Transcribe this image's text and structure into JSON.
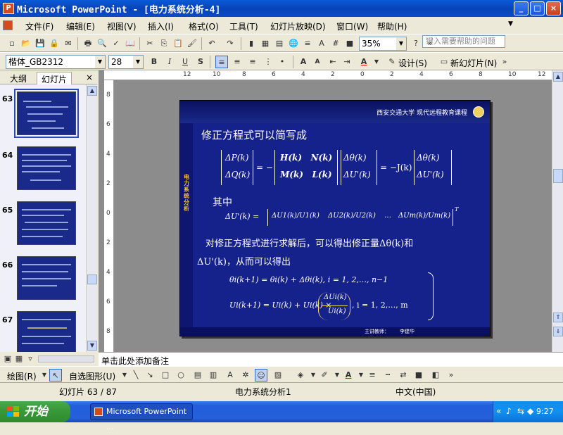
{
  "window": {
    "title": "Microsoft PowerPoint - [电力系统分析-4]",
    "controls": [
      "_",
      "□",
      "×"
    ]
  },
  "menu": {
    "items": [
      "文件(F)",
      "编辑(E)",
      "视图(V)",
      "插入(I)",
      "格式(O)",
      "工具(T)",
      "幻灯片放映(D)",
      "窗口(W)",
      "帮助(H)"
    ],
    "ask_placeholder": "键入需要帮助的问题"
  },
  "toolbar": {
    "zoom": "35%",
    "font_name": "楷体_GB2312",
    "font_size": "28",
    "design_label": "设计(S)",
    "new_slide_label": "新幻灯片(N)"
  },
  "left_pane": {
    "tabs": [
      "大纲",
      "幻灯片"
    ],
    "active_tab": "幻灯片",
    "slides": [
      "63",
      "64",
      "65",
      "66",
      "67"
    ],
    "selected": "63"
  },
  "rulers": {
    "h_ticks": [
      "12",
      "10",
      "8",
      "6",
      "4",
      "2",
      "0",
      "2",
      "4",
      "6",
      "8",
      "10",
      "12"
    ],
    "v_ticks": [
      "8",
      "6",
      "4",
      "2",
      "0",
      "2",
      "4",
      "6",
      "8"
    ]
  },
  "slide": {
    "header": "西安交通大学  现代远程教育课程",
    "side_title": "电力系统分析",
    "line1": "修正方程式可以简写成",
    "line2": "其中",
    "line3": "对修正方程式进行求解后，可以得出修正量Δθ(k)和",
    "line4": "ΔU'(k)，从而可以得出",
    "eq_main_lhs": [
      "ΔP(k)",
      "ΔQ(k)"
    ],
    "eq_main_mid": [
      "H(k)   N(k)",
      "M(k)   L(k)"
    ],
    "eq_main_vec": [
      "Δθ(k)",
      "ΔU'(k)"
    ],
    "eq_main_rhs_vec": [
      "Δθ(k)",
      "ΔU'(k)"
    ],
    "eq_main_sign": "= −",
    "eq_main_sign2": "= −J(k)",
    "eq_def_lhs": "ΔU'(k) =",
    "eq_def_terms": [
      "ΔU1(k)/U1(k)",
      "ΔU2(k)/U2(k)",
      "…",
      "ΔUm(k)/Um(k)"
    ],
    "eq_def_T": "T",
    "eq_theta": "θi(k+1) = θi(k) + Δθi(k),   i = 1,  2,…,  n−1",
    "eq_u_lhs": "Ui(k+1) = Ui(k) + Ui(k) ×",
    "eq_u_frac_num": "ΔUi(k)",
    "eq_u_frac_den": "Ui(k)",
    "eq_u_tail": ",   i = 1,   2,…,   m",
    "footer_label": "主讲教师：",
    "footer_name": "李建华"
  },
  "notes": {
    "placeholder": "单击此处添加备注"
  },
  "drawbar": {
    "draw_label": "绘图(R)",
    "autoshape_label": "自选图形(U)"
  },
  "status": {
    "slide_info": "幻灯片 63 / 87",
    "design": "电力系统分析1",
    "language": "中文(中国)"
  },
  "taskbar": {
    "start": "开始",
    "task_button": "Microsoft PowerPoint ...",
    "clock": "9:27"
  },
  "colors": {
    "slide_bg": "#16228c",
    "slide_text": "#ffffff",
    "slide_accent": "#f8e060",
    "titlebar": "#0a4ac8",
    "taskbar": "#245edc",
    "start_button": "#3a9a3a"
  }
}
